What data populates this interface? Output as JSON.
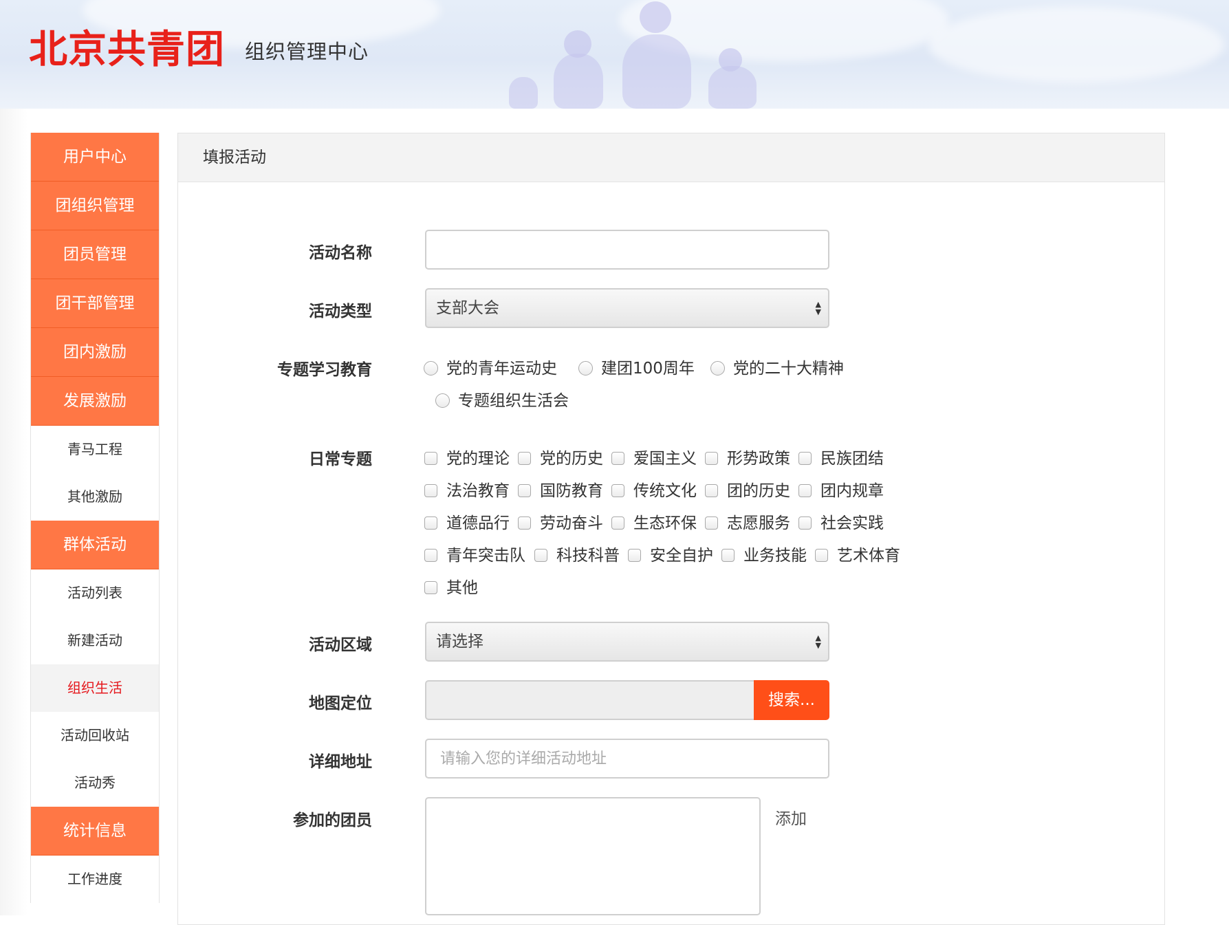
{
  "header": {
    "logo_text": "北京共青团",
    "site_subtitle": "组织管理中心"
  },
  "sidebar": {
    "items": [
      {
        "label": "用户中心",
        "type": "main"
      },
      {
        "label": "团组织管理",
        "type": "main"
      },
      {
        "label": "团员管理",
        "type": "main"
      },
      {
        "label": "团干部管理",
        "type": "main"
      },
      {
        "label": "团内激励",
        "type": "main"
      },
      {
        "label": "发展激励",
        "type": "main"
      },
      {
        "label": "青马工程",
        "type": "sub"
      },
      {
        "label": "其他激励",
        "type": "sub"
      },
      {
        "label": "群体活动",
        "type": "main"
      },
      {
        "label": "活动列表",
        "type": "sub"
      },
      {
        "label": "新建活动",
        "type": "sub"
      },
      {
        "label": "组织生活",
        "type": "sub",
        "active": true
      },
      {
        "label": "活动回收站",
        "type": "sub"
      },
      {
        "label": "活动秀",
        "type": "sub"
      },
      {
        "label": "统计信息",
        "type": "main"
      },
      {
        "label": "工作进度",
        "type": "sub"
      }
    ]
  },
  "panel": {
    "title": "填报活动"
  },
  "form": {
    "activity_name": {
      "label": "活动名称",
      "value": ""
    },
    "activity_type": {
      "label": "活动类型",
      "selected": "支部大会"
    },
    "special_study": {
      "label": "专题学习教育",
      "options": [
        "党的青年运动史",
        "建团100周年",
        "党的二十大精神",
        "专题组织生活会"
      ]
    },
    "daily_topics": {
      "label": "日常专题",
      "options": [
        "党的理论",
        "党的历史",
        "爱国主义",
        "形势政策",
        "民族团结",
        "法治教育",
        "国防教育",
        "传统文化",
        "团的历史",
        "团内规章",
        "道德品行",
        "劳动奋斗",
        "生态环保",
        "志愿服务",
        "社会实践",
        "青年突击队",
        "科技科普",
        "安全自护",
        "业务技能",
        "艺术体育",
        "其他"
      ]
    },
    "activity_area": {
      "label": "活动区域",
      "selected": "请选择"
    },
    "map_location": {
      "label": "地图定位",
      "value": "",
      "button_label": "搜索..."
    },
    "detail_address": {
      "label": "详细地址",
      "placeholder": "请输入您的详细活动地址",
      "value": ""
    },
    "participants": {
      "label": "参加的团员",
      "add_label": "添加"
    }
  },
  "colors": {
    "brand_red": "#e8211a",
    "sidebar_orange": "#ff7745",
    "search_button": "#ff4f18",
    "active_text": "#e5181d"
  }
}
